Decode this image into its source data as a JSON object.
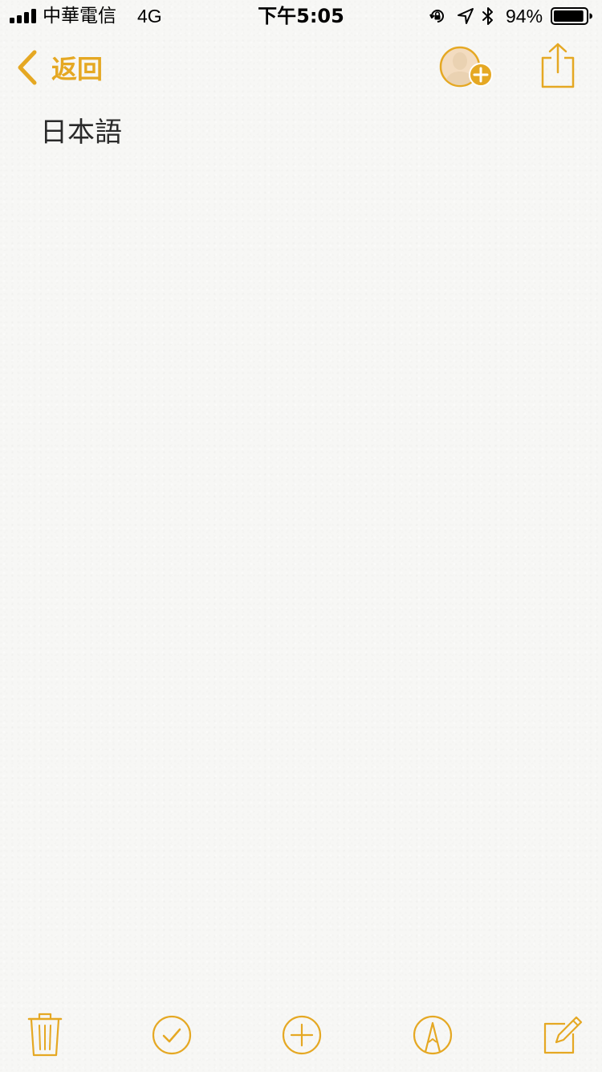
{
  "status_bar": {
    "carrier": "中華電信",
    "network": "4G",
    "time": "下午5:05",
    "battery_percent": "94%",
    "battery_level": 0.94,
    "signal_bars": 4
  },
  "nav": {
    "back_label": "返回",
    "icons": [
      "chevron-left-icon",
      "add-person-icon",
      "share-icon"
    ]
  },
  "note": {
    "text": "日本語"
  },
  "toolbar": {
    "icons": [
      "trash-icon",
      "checklist-icon",
      "add-icon",
      "markup-icon",
      "compose-icon"
    ]
  },
  "colors": {
    "accent": "#e5a823",
    "background": "#f7f7f5",
    "text": "#2a2a2a"
  }
}
